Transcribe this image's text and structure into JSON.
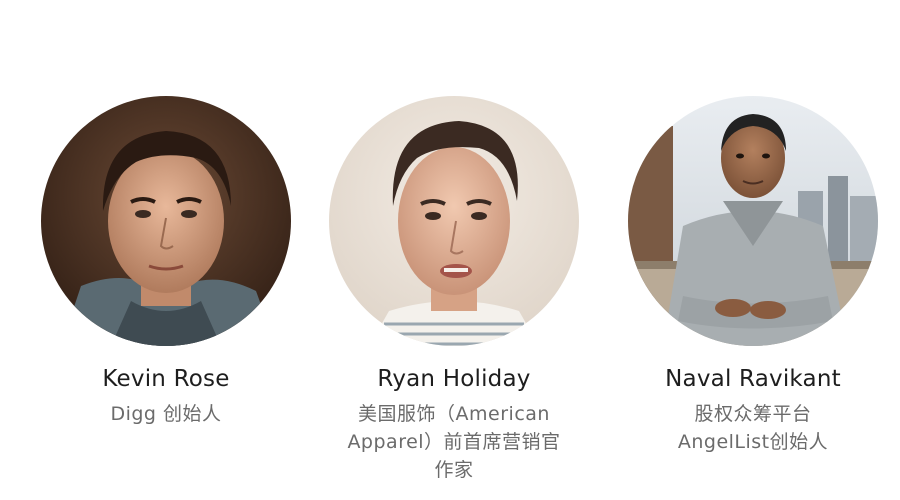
{
  "people": [
    {
      "name": "Kevin Rose",
      "role_lines": [
        "Digg 创始人"
      ],
      "photo_icon": "portrait-photo"
    },
    {
      "name": "Ryan Holiday",
      "role_lines": [
        "美国服饰（American",
        "Apparel）前首席营销官",
        "作家"
      ],
      "photo_icon": "portrait-photo"
    },
    {
      "name": "Naval Ravikant",
      "role_lines": [
        "股权众筹平台",
        "AngelList创始人"
      ],
      "photo_icon": "portrait-photo"
    }
  ],
  "colors": {
    "name_text": "#1e1e1e",
    "role_text": "#6b6b6b",
    "background": "#ffffff"
  }
}
